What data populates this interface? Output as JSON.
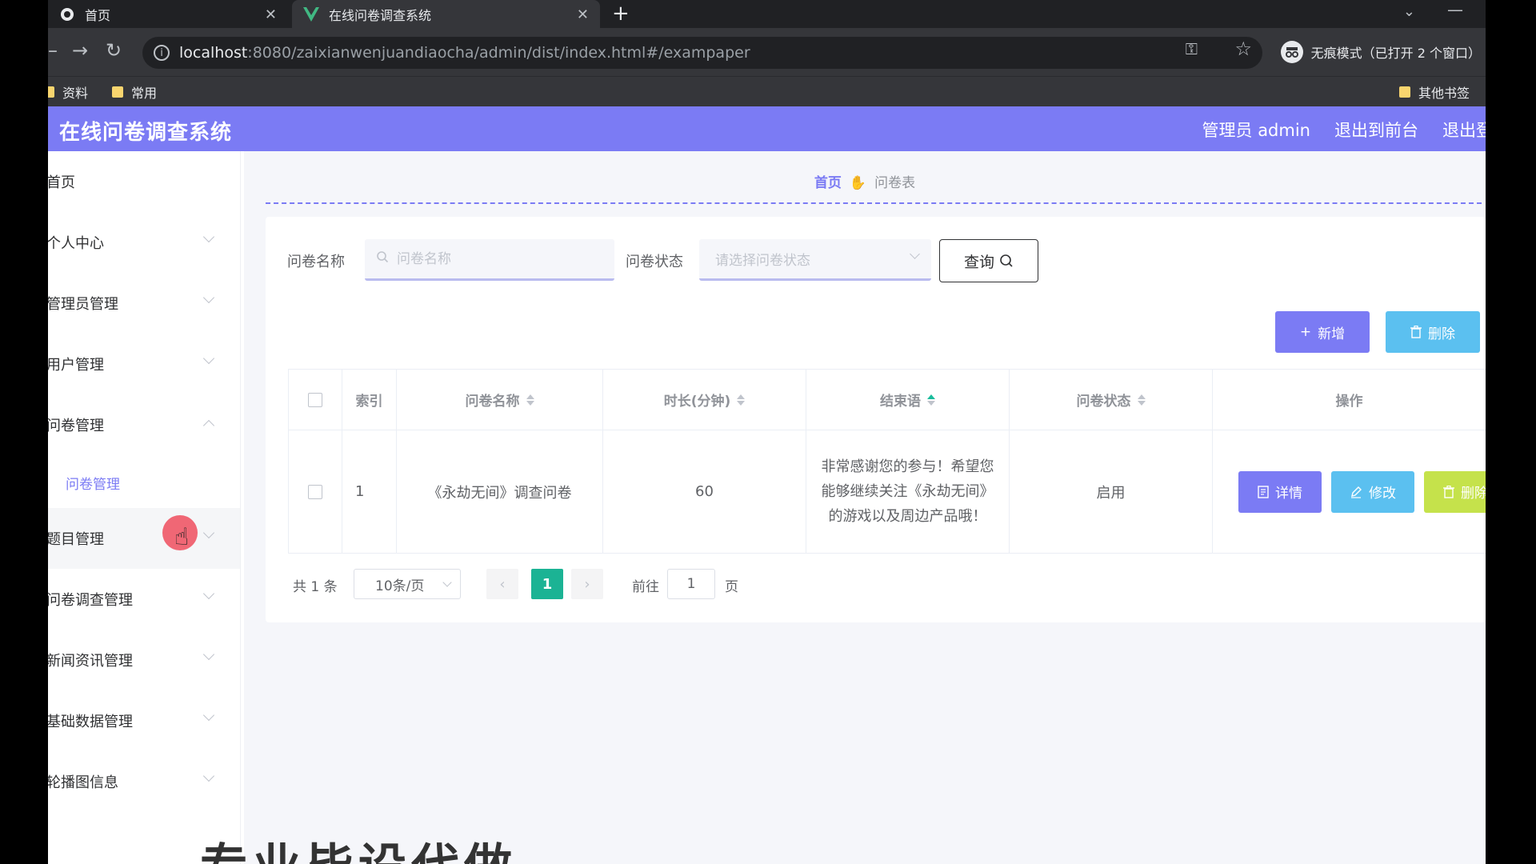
{
  "browser": {
    "tabs": [
      {
        "title": "首页"
      },
      {
        "title": "在线问卷调查系统"
      }
    ],
    "url_host": "localhost",
    "url_path": ":8080/zaixianwenjuandiaocha/admin/dist/index.html#/exampaper",
    "incognito_text": "无痕模式（已打开 2 个窗口）",
    "bookmarks": [
      "资料",
      "常用"
    ],
    "other_bookmarks": "其他书签"
  },
  "header": {
    "title": "在线问卷调查系统",
    "admin": "管理员 admin",
    "to_front": "退出到前台",
    "logout": "退出登录"
  },
  "sidebar": {
    "items": [
      {
        "label": "首页"
      },
      {
        "label": "个人中心"
      },
      {
        "label": "管理员管理"
      },
      {
        "label": "用户管理"
      },
      {
        "label": "问卷管理"
      },
      {
        "label": "题目管理"
      },
      {
        "label": "问卷调查管理"
      },
      {
        "label": "新闻资讯管理"
      },
      {
        "label": "基础数据管理"
      },
      {
        "label": "轮播图信息"
      }
    ],
    "submenu": "问卷管理"
  },
  "breadcrumb": {
    "home": "首页",
    "current": "问卷表"
  },
  "filters": {
    "name_label": "问卷名称",
    "name_placeholder": "问卷名称",
    "status_label": "问卷状态",
    "status_placeholder": "请选择问卷状态",
    "query_label": "查询"
  },
  "actions": {
    "add": "新增",
    "delete": "删除"
  },
  "table": {
    "headers": [
      "索引",
      "问卷名称",
      "时长(分钟)",
      "结束语",
      "问卷状态",
      "操作"
    ],
    "rows": [
      {
        "index": "1",
        "name": "《永劫无间》调查问卷",
        "duration": "60",
        "ending": "非常感谢您的参与！希望您能够继续关注《永劫无间》的游戏以及周边产品哦！",
        "status": "启用"
      }
    ],
    "row_actions": {
      "detail": "详情",
      "edit": "修改",
      "delete": "删除"
    }
  },
  "pagination": {
    "total": "共 1 条",
    "page_size": "10条/页",
    "current_page": "1",
    "goto_label": "前往",
    "goto_value": "1",
    "page_unit": "页"
  },
  "overlay_text": "专业毕设代做",
  "colors": {
    "primary": "#7b7bf4",
    "info": "#5bc0f0",
    "success": "#1bb394",
    "warning": "#c5e24b"
  }
}
